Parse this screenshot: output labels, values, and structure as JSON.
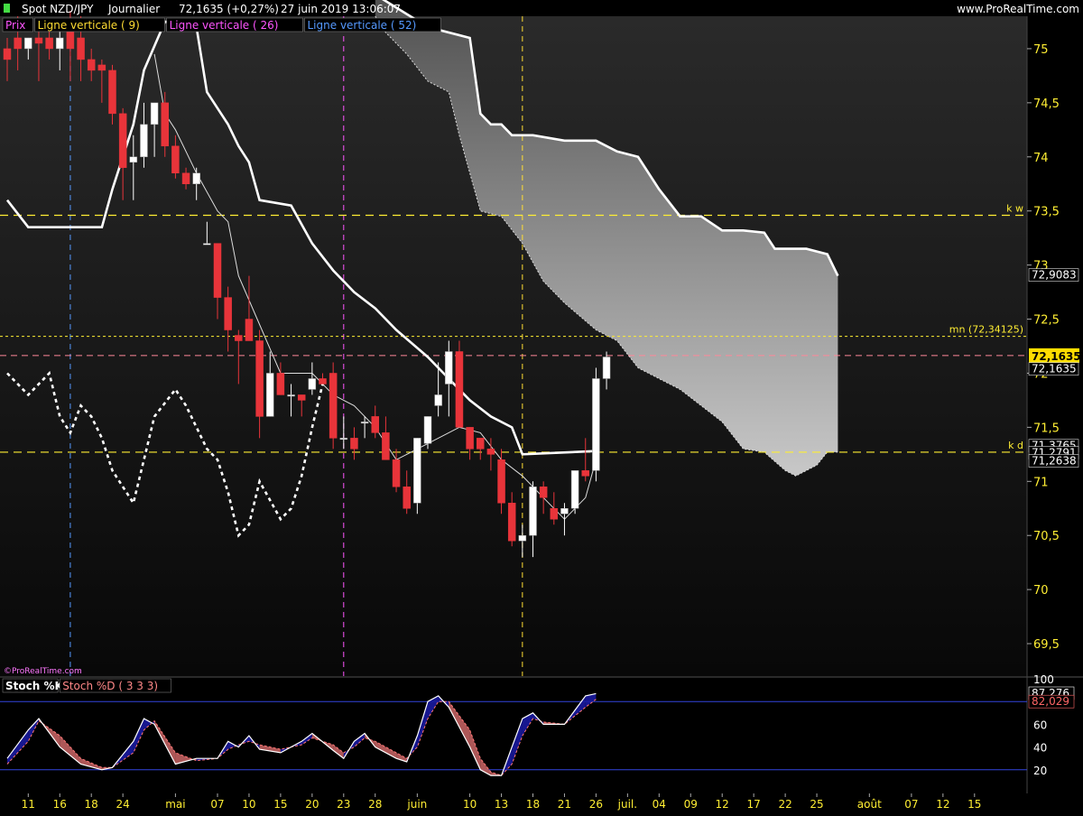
{
  "header": {
    "instrument": "Spot NZD/JPY",
    "period": "Journalier",
    "price_change": "72,1635 (+0,27%)",
    "datetime": "27 juin 2019 13:06:07",
    "brand": "www.ProRealTime.com",
    "watermark": "©ProRealTime.com"
  },
  "legend_main": [
    {
      "label": "Prix",
      "color": "#ff55ff"
    },
    {
      "label": "Ligne verticale ( 9)",
      "color": "#ffdd33"
    },
    {
      "label": "Ligne verticale ( 26)",
      "color": "#ff55ff"
    },
    {
      "label": "Ligne verticale ( 52)",
      "color": "#5599ff"
    }
  ],
  "legend_stoch": [
    {
      "label": "Stoch %K",
      "color": "#ffffff"
    },
    {
      "label": "Stoch %D ( 3 3 3)",
      "color": "#ff8888"
    }
  ],
  "levels": {
    "kw": {
      "label": "k w",
      "value": 73.46
    },
    "kd": {
      "label": "k d",
      "value": 71.27
    },
    "mn": {
      "label": "mn (72,34125)",
      "value": 72.34125
    }
  },
  "price_tags": [
    {
      "text": "72,9083",
      "value": 72.9083,
      "style": "box"
    },
    {
      "text": "72,1635",
      "value": 72.1635,
      "style": "current"
    },
    {
      "text": "72,1635",
      "value": 72.04,
      "style": "box"
    },
    {
      "text": "71,3765",
      "value": 71.33,
      "style": "box"
    },
    {
      "text": "71,2791",
      "value": 71.265,
      "style": "box"
    },
    {
      "text": "71,2638",
      "value": 71.19,
      "style": "box"
    }
  ],
  "stoch_tags": [
    {
      "text": "87,276",
      "value": 87.3,
      "color": "#ffffff"
    },
    {
      "text": "82,029",
      "value": 80.0,
      "color": "#ff6666"
    }
  ],
  "colors": {
    "bull": "#ffffff",
    "bear": "#e8343a",
    "kw": "#ffee33",
    "mn": "#ffee33",
    "pink": "#ff8899"
  },
  "chart_data": {
    "type": "candlestick",
    "ylim": [
      69.2,
      75.3
    ],
    "y_ticks": [
      {
        "v": 75,
        "t": "75"
      },
      {
        "v": 74.5,
        "t": "74,5"
      },
      {
        "v": 74,
        "t": "74"
      },
      {
        "v": 73.5,
        "t": "73,5"
      },
      {
        "v": 73,
        "t": "73"
      },
      {
        "v": 72.5,
        "t": "72,5"
      },
      {
        "v": 72,
        "t": "72"
      },
      {
        "v": 71.5,
        "t": "71,5"
      },
      {
        "v": 71,
        "t": "71"
      },
      {
        "v": 70.5,
        "t": "70,5"
      },
      {
        "v": 70,
        "t": "70"
      },
      {
        "v": 69.5,
        "t": "69,5"
      }
    ],
    "stoch_ylim": [
      0,
      100
    ],
    "stoch_ticks": [
      {
        "v": 100,
        "t": "100"
      },
      {
        "v": 80,
        "t": "80"
      },
      {
        "v": 60,
        "t": "60"
      },
      {
        "v": 40,
        "t": "40"
      },
      {
        "v": 20,
        "t": "20"
      }
    ],
    "x_ticks": [
      {
        "i": 2,
        "t": "11"
      },
      {
        "i": 5,
        "t": "16"
      },
      {
        "i": 8,
        "t": "18"
      },
      {
        "i": 11,
        "t": "24"
      },
      {
        "i": 16,
        "t": "mai"
      },
      {
        "i": 20,
        "t": "07"
      },
      {
        "i": 23,
        "t": "10"
      },
      {
        "i": 26,
        "t": "15"
      },
      {
        "i": 29,
        "t": "20"
      },
      {
        "i": 32,
        "t": "23"
      },
      {
        "i": 35,
        "t": "28"
      },
      {
        "i": 39,
        "t": "juin"
      },
      {
        "i": 44,
        "t": "10"
      },
      {
        "i": 47,
        "t": "13"
      },
      {
        "i": 50,
        "t": "18"
      },
      {
        "i": 53,
        "t": "21"
      },
      {
        "i": 56,
        "t": "26"
      },
      {
        "i": 59,
        "t": "juil."
      },
      {
        "i": 62,
        "t": "04"
      },
      {
        "i": 65,
        "t": "09"
      },
      {
        "i": 68,
        "t": "12"
      },
      {
        "i": 71,
        "t": "17"
      },
      {
        "i": 74,
        "t": "22"
      },
      {
        "i": 77,
        "t": "25"
      },
      {
        "i": 82,
        "t": "août"
      },
      {
        "i": 86,
        "t": "07"
      },
      {
        "i": 89,
        "t": "12"
      },
      {
        "i": 92,
        "t": "15"
      }
    ],
    "vertical_lines": [
      {
        "i": 6,
        "color": "#5599ff"
      },
      {
        "i": 32,
        "color": "#ff55ff"
      },
      {
        "i": 49,
        "color": "#ffdd33"
      }
    ],
    "candles": [
      [
        75.0,
        75.1,
        74.7,
        74.9
      ],
      [
        75.1,
        75.3,
        74.8,
        75.0
      ],
      [
        75.0,
        75.1,
        74.9,
        75.1
      ],
      [
        75.1,
        75.2,
        74.7,
        75.05
      ],
      [
        75.1,
        75.25,
        74.9,
        75.0
      ],
      [
        75.0,
        75.2,
        74.8,
        75.1
      ],
      [
        75.2,
        75.35,
        74.7,
        75.0
      ],
      [
        75.1,
        75.3,
        74.7,
        74.9
      ],
      [
        74.9,
        75.0,
        74.7,
        74.8
      ],
      [
        74.85,
        74.9,
        74.5,
        74.8
      ],
      [
        74.8,
        74.85,
        74.3,
        74.4
      ],
      [
        74.4,
        74.45,
        73.6,
        73.9
      ],
      [
        73.95,
        74.2,
        73.6,
        74.0
      ],
      [
        74.0,
        74.5,
        73.9,
        74.3
      ],
      [
        74.3,
        74.5,
        74.0,
        74.5
      ],
      [
        74.5,
        74.6,
        74.0,
        74.1
      ],
      [
        74.1,
        74.2,
        73.8,
        73.85
      ],
      [
        73.85,
        73.9,
        73.7,
        73.75
      ],
      [
        73.75,
        73.9,
        73.6,
        73.85
      ],
      [
        73.2,
        73.4,
        73.2,
        73.2
      ],
      [
        73.2,
        73.2,
        72.5,
        72.7
      ],
      [
        72.7,
        72.8,
        72.2,
        72.4
      ],
      [
        72.35,
        72.4,
        71.9,
        72.3
      ],
      [
        72.5,
        72.9,
        72.3,
        72.3
      ],
      [
        72.3,
        72.4,
        71.4,
        71.6
      ],
      [
        71.6,
        72.2,
        71.6,
        72.0
      ],
      [
        72.0,
        72.1,
        71.8,
        71.8
      ],
      [
        71.8,
        71.9,
        71.6,
        71.8
      ],
      [
        71.8,
        71.8,
        71.6,
        71.75
      ],
      [
        71.85,
        72.1,
        71.8,
        71.95
      ],
      [
        71.95,
        72.0,
        71.9,
        71.9
      ],
      [
        72.0,
        72.1,
        71.3,
        71.4
      ],
      [
        71.4,
        71.6,
        71.3,
        71.4
      ],
      [
        71.4,
        71.5,
        71.2,
        71.3
      ],
      [
        71.55,
        71.6,
        71.4,
        71.55
      ],
      [
        71.6,
        71.7,
        71.4,
        71.45
      ],
      [
        71.45,
        71.6,
        71.2,
        71.2
      ],
      [
        71.2,
        71.3,
        70.9,
        70.95
      ],
      [
        70.95,
        71.1,
        70.7,
        70.75
      ],
      [
        70.8,
        71.4,
        70.7,
        71.4
      ],
      [
        71.35,
        71.6,
        71.3,
        71.6
      ],
      [
        71.7,
        72.1,
        71.6,
        71.8
      ],
      [
        71.9,
        72.3,
        71.6,
        72.2
      ],
      [
        72.2,
        72.3,
        71.5,
        71.5
      ],
      [
        71.5,
        71.5,
        71.2,
        71.3
      ],
      [
        71.4,
        71.4,
        71.2,
        71.3
      ],
      [
        71.3,
        71.4,
        71.1,
        71.25
      ],
      [
        71.2,
        71.3,
        70.7,
        70.8
      ],
      [
        70.8,
        70.9,
        70.4,
        70.45
      ],
      [
        70.45,
        70.6,
        70.3,
        70.5
      ],
      [
        70.5,
        71.0,
        70.3,
        70.95
      ],
      [
        70.95,
        71.0,
        70.7,
        70.85
      ],
      [
        70.75,
        70.9,
        70.6,
        70.65
      ],
      [
        70.7,
        70.8,
        70.5,
        70.75
      ],
      [
        70.75,
        71.1,
        70.7,
        71.1
      ],
      [
        71.1,
        71.4,
        71.0,
        71.05
      ],
      [
        71.1,
        72.05,
        71.0,
        71.95
      ],
      [
        71.95,
        72.2,
        71.85,
        72.15
      ]
    ],
    "tenkan": [
      [
        14,
        74.95
      ],
      [
        15,
        74.4
      ],
      [
        16,
        74.25
      ],
      [
        18,
        73.85
      ],
      [
        20,
        73.5
      ],
      [
        21,
        73.4
      ],
      [
        22,
        72.9
      ],
      [
        24,
        72.45
      ],
      [
        26,
        72.0
      ],
      [
        29,
        72.0
      ],
      [
        31,
        71.8
      ],
      [
        33,
        71.7
      ],
      [
        35,
        71.5
      ],
      [
        37,
        71.2
      ],
      [
        40,
        71.35
      ],
      [
        43,
        71.5
      ],
      [
        45,
        71.45
      ],
      [
        47,
        71.2
      ],
      [
        49,
        71.05
      ],
      [
        51,
        70.85
      ],
      [
        53,
        70.65
      ],
      [
        55,
        70.85
      ],
      [
        56,
        71.2
      ]
    ],
    "kijun": [
      [
        0,
        73.6
      ],
      [
        2,
        73.35
      ],
      [
        9,
        73.35
      ],
      [
        10,
        73.7
      ],
      [
        12,
        74.3
      ],
      [
        13,
        74.8
      ],
      [
        15,
        75.25
      ],
      [
        18,
        75.2
      ],
      [
        19,
        74.6
      ],
      [
        21,
        74.3
      ],
      [
        22,
        74.1
      ],
      [
        23,
        73.95
      ],
      [
        24,
        73.6
      ],
      [
        27,
        73.55
      ],
      [
        29,
        73.2
      ],
      [
        31,
        72.95
      ],
      [
        33,
        72.75
      ],
      [
        35,
        72.6
      ],
      [
        37,
        72.4
      ],
      [
        40,
        72.15
      ],
      [
        42,
        71.95
      ],
      [
        44,
        71.75
      ],
      [
        46,
        71.6
      ],
      [
        48,
        71.5
      ],
      [
        49,
        71.25
      ],
      [
        56,
        71.28
      ]
    ],
    "chikou": [
      [
        0,
        72.0
      ],
      [
        2,
        71.8
      ],
      [
        3,
        71.9
      ],
      [
        4,
        72.0
      ],
      [
        5,
        71.6
      ],
      [
        6,
        71.45
      ],
      [
        7,
        71.7
      ],
      [
        8,
        71.6
      ],
      [
        9,
        71.4
      ],
      [
        10,
        71.1
      ],
      [
        12,
        70.8
      ],
      [
        13,
        71.2
      ],
      [
        14,
        71.6
      ],
      [
        16,
        71.85
      ],
      [
        17,
        71.7
      ],
      [
        19,
        71.3
      ],
      [
        20,
        71.2
      ],
      [
        21,
        70.9
      ],
      [
        22,
        70.5
      ],
      [
        23,
        70.6
      ],
      [
        24,
        71.0
      ],
      [
        26,
        70.65
      ],
      [
        27,
        70.75
      ],
      [
        28,
        71.05
      ],
      [
        29,
        71.5
      ],
      [
        30,
        71.9
      ]
    ],
    "ssa": [
      [
        35,
        75.5
      ],
      [
        40,
        75.2
      ],
      [
        44,
        75.1
      ],
      [
        45,
        74.4
      ],
      [
        46,
        74.3
      ],
      [
        47,
        74.3
      ],
      [
        48,
        74.2
      ],
      [
        50,
        74.2
      ],
      [
        53,
        74.15
      ],
      [
        56,
        74.15
      ],
      [
        58,
        74.05
      ],
      [
        60,
        74.0
      ],
      [
        62,
        73.7
      ],
      [
        64,
        73.45
      ],
      [
        66,
        73.45
      ],
      [
        68,
        73.32
      ],
      [
        70,
        73.32
      ],
      [
        72,
        73.3
      ],
      [
        73,
        73.15
      ],
      [
        76,
        73.15
      ],
      [
        78,
        73.1
      ],
      [
        79,
        72.9
      ]
    ],
    "ssb": [
      [
        35,
        75.3
      ],
      [
        36,
        75.15
      ],
      [
        38,
        74.95
      ],
      [
        40,
        74.7
      ],
      [
        42,
        74.6
      ],
      [
        43,
        74.2
      ],
      [
        45,
        73.5
      ],
      [
        47,
        73.45
      ],
      [
        49,
        73.2
      ],
      [
        51,
        72.85
      ],
      [
        53,
        72.65
      ],
      [
        56,
        72.4
      ],
      [
        58,
        72.3
      ],
      [
        60,
        72.05
      ],
      [
        62,
        71.95
      ],
      [
        64,
        71.85
      ],
      [
        66,
        71.7
      ],
      [
        68,
        71.55
      ],
      [
        70,
        71.3
      ],
      [
        72,
        71.27
      ],
      [
        74,
        71.1
      ],
      [
        75,
        71.05
      ],
      [
        77,
        71.15
      ],
      [
        78,
        71.27
      ],
      [
        79,
        71.27
      ]
    ],
    "stoch_k": [
      [
        0,
        30
      ],
      [
        2,
        55
      ],
      [
        3,
        65
      ],
      [
        5,
        40
      ],
      [
        7,
        25
      ],
      [
        9,
        20
      ],
      [
        10,
        22
      ],
      [
        12,
        45
      ],
      [
        13,
        65
      ],
      [
        14,
        60
      ],
      [
        16,
        25
      ],
      [
        18,
        30
      ],
      [
        20,
        30
      ],
      [
        21,
        45
      ],
      [
        22,
        40
      ],
      [
        23,
        50
      ],
      [
        24,
        38
      ],
      [
        26,
        35
      ],
      [
        28,
        45
      ],
      [
        29,
        52
      ],
      [
        31,
        37
      ],
      [
        32,
        30
      ],
      [
        33,
        45
      ],
      [
        34,
        52
      ],
      [
        35,
        40
      ],
      [
        37,
        30
      ],
      [
        38,
        27
      ],
      [
        39,
        50
      ],
      [
        40,
        80
      ],
      [
        41,
        85
      ],
      [
        42,
        75
      ],
      [
        44,
        40
      ],
      [
        45,
        20
      ],
      [
        46,
        15
      ],
      [
        47,
        15
      ],
      [
        48,
        40
      ],
      [
        49,
        65
      ],
      [
        50,
        70
      ],
      [
        51,
        60
      ],
      [
        53,
        60
      ],
      [
        55,
        85
      ],
      [
        56,
        87
      ]
    ],
    "stoch_d": [
      [
        0,
        25
      ],
      [
        2,
        45
      ],
      [
        3,
        63
      ],
      [
        5,
        50
      ],
      [
        7,
        30
      ],
      [
        9,
        22
      ],
      [
        10,
        22
      ],
      [
        12,
        35
      ],
      [
        13,
        55
      ],
      [
        14,
        63
      ],
      [
        16,
        35
      ],
      [
        18,
        28
      ],
      [
        20,
        30
      ],
      [
        21,
        38
      ],
      [
        22,
        42
      ],
      [
        23,
        45
      ],
      [
        24,
        42
      ],
      [
        26,
        38
      ],
      [
        28,
        42
      ],
      [
        29,
        48
      ],
      [
        31,
        42
      ],
      [
        32,
        35
      ],
      [
        33,
        40
      ],
      [
        34,
        48
      ],
      [
        35,
        45
      ],
      [
        37,
        35
      ],
      [
        38,
        30
      ],
      [
        39,
        40
      ],
      [
        40,
        65
      ],
      [
        41,
        80
      ],
      [
        42,
        80
      ],
      [
        44,
        55
      ],
      [
        45,
        30
      ],
      [
        46,
        18
      ],
      [
        47,
        15
      ],
      [
        48,
        25
      ],
      [
        49,
        50
      ],
      [
        50,
        65
      ],
      [
        51,
        62
      ],
      [
        53,
        60
      ],
      [
        55,
        75
      ],
      [
        56,
        82
      ]
    ]
  }
}
